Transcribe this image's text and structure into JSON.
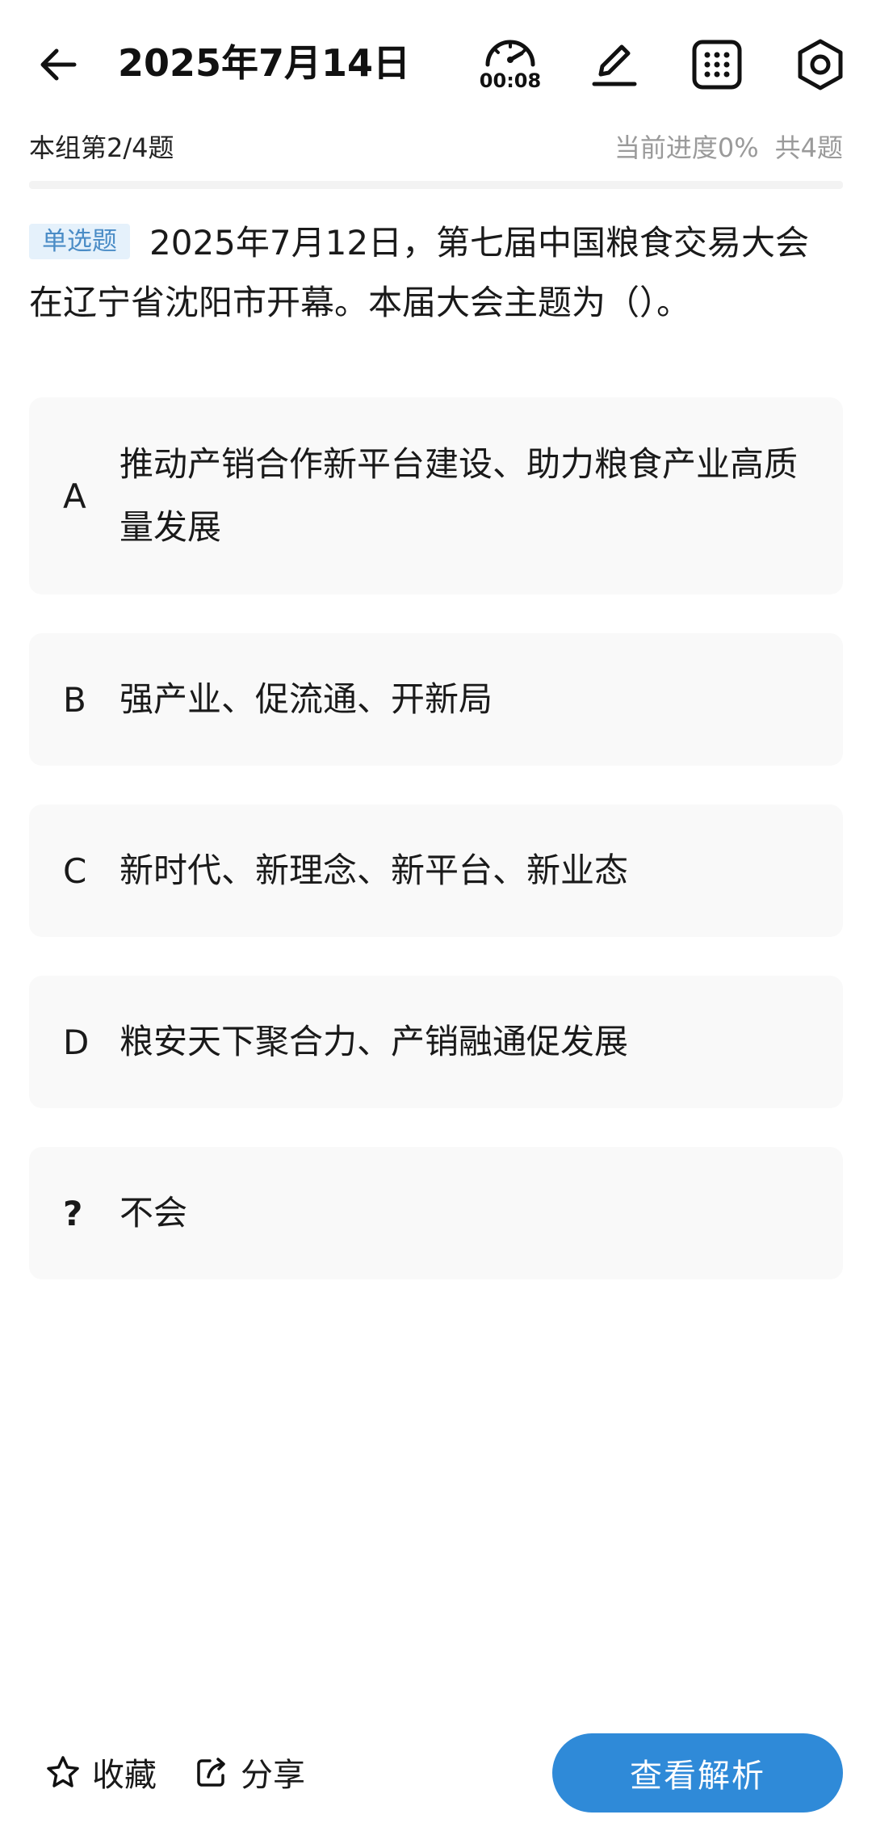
{
  "header": {
    "title": "2025年7月14日",
    "timer": "00:08",
    "icons": [
      "back-arrow-icon",
      "timer-icon",
      "edit-icon",
      "grid-icon",
      "settings-icon"
    ]
  },
  "progress": {
    "group": "本组第2/4题",
    "current": "当前进度0%",
    "total": "共4题"
  },
  "question": {
    "type": "单选题",
    "text": "2025年7月12日，第七届中国粮食交易大会在辽宁省沈阳市开幕。本届大会主题为（）。"
  },
  "options": [
    {
      "letter": "A",
      "text": "推动产销合作新平台建设、助力粮食产业高质量发展"
    },
    {
      "letter": "B",
      "text": "强产业、促流通、开新局"
    },
    {
      "letter": "C",
      "text": "新时代、新理念、新平台、新业态"
    },
    {
      "letter": "D",
      "text": "粮安天下聚合力、产销融通促发展"
    },
    {
      "letter": "?",
      "text": "不会"
    }
  ],
  "bottom": {
    "favorite": "收藏",
    "share": "分享",
    "analysis": "查看解析"
  },
  "colors": {
    "accent": "#2f8ad8",
    "badge_bg": "#e5f1fb",
    "badge_text": "#4a8cc6",
    "option_bg": "#f9f9f9",
    "muted_text": "#9a9a9a"
  }
}
